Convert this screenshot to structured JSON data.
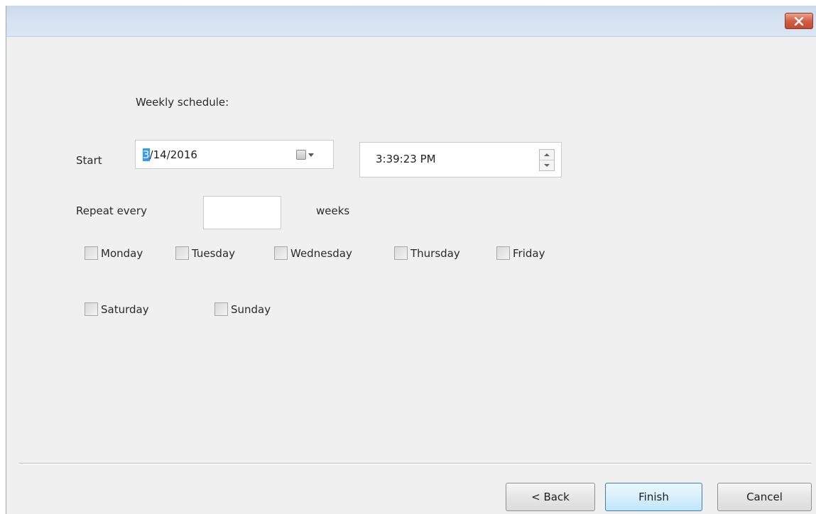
{
  "dialog": {
    "close_symbol": "✕",
    "heading": "Weekly schedule:"
  },
  "start": {
    "label": "Start",
    "date_selected": "3",
    "date_rest": "/14/2016",
    "calendar_icon": "calendar-icon",
    "time": "3:39:23 PM"
  },
  "repeat": {
    "label": "Repeat every",
    "value": "",
    "unit": "weeks"
  },
  "days": [
    {
      "label": "Monday",
      "checked": false
    },
    {
      "label": "Tuesday",
      "checked": false
    },
    {
      "label": "Wednesday",
      "checked": false
    },
    {
      "label": "Thursday",
      "checked": false
    },
    {
      "label": "Friday",
      "checked": false
    },
    {
      "label": "Saturday",
      "checked": false
    },
    {
      "label": "Sunday",
      "checked": false
    }
  ],
  "buttons": {
    "back": "< Back",
    "finish": "Finish",
    "cancel": "Cancel"
  },
  "colors": {
    "title_bar": "#d5e2f1",
    "close_button": "#c44a30",
    "selection": "#3399ff",
    "dialog_bg": "#f0f0f0"
  }
}
